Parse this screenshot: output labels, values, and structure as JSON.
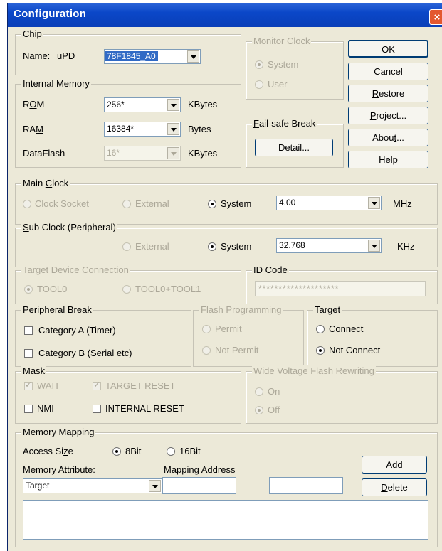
{
  "window": {
    "title": "Configuration",
    "close_glyph": "×"
  },
  "chip": {
    "group": "Chip",
    "name_label": "Name:",
    "prefix": "uPD",
    "value": "78F1845_A0"
  },
  "monitor_clock": {
    "group": "Monitor Clock",
    "system": "System",
    "user": "User"
  },
  "internal_memory": {
    "group": "Internal Memory",
    "rom_label": "ROM",
    "rom_value": "256*",
    "rom_unit": "KBytes",
    "ram_label": "RAM",
    "ram_value": "16384*",
    "ram_unit": "Bytes",
    "dataflash_label": "DataFlash",
    "dataflash_value": "16*",
    "dataflash_unit": "KBytes"
  },
  "failsafe": {
    "group": "Fail-safe Break",
    "detail_button": "Detail..."
  },
  "buttons": {
    "ok": "OK",
    "cancel": "Cancel",
    "restore": "Restore",
    "project": "Project...",
    "about": "About...",
    "help": "Help"
  },
  "main_clock": {
    "group": "Main Clock",
    "clock_socket": "Clock Socket",
    "external": "External",
    "system": "System",
    "value": "4.00",
    "unit": "MHz"
  },
  "sub_clock": {
    "group": "Sub Clock (Peripheral)",
    "external": "External",
    "system": "System",
    "value": "32.768",
    "unit": "KHz"
  },
  "target_device": {
    "group": "Target Device Connection",
    "tool0": "TOOL0",
    "tool0_tool1": "TOOL0+TOOL1"
  },
  "id_code": {
    "group": "ID Code",
    "value": "********************"
  },
  "peripheral_break": {
    "group": "Peripheral Break",
    "cat_a": "Category A (Timer)",
    "cat_b": "Category B (Serial etc)"
  },
  "flash_programming": {
    "group": "Flash Programming",
    "permit": "Permit",
    "not_permit": "Not Permit"
  },
  "target": {
    "group": "Target",
    "connect": "Connect",
    "not_connect": "Not Connect"
  },
  "mask": {
    "group": "Mask",
    "wait": "WAIT",
    "target_reset": "TARGET RESET",
    "nmi": "NMI",
    "internal_reset": "INTERNAL RESET"
  },
  "wide_voltage": {
    "group": "Wide Voltage Flash Rewriting",
    "on": "On",
    "off": "Off"
  },
  "memory_mapping": {
    "group": "Memory Mapping",
    "access_size_label": "Access Size",
    "bit8": "8Bit",
    "bit16": "16Bit",
    "attribute_label": "Memory Attribute",
    "attribute_value": "Target",
    "address_label": "Mapping Address",
    "dash": "—",
    "add_button": "Add",
    "delete_button": "Delete"
  }
}
